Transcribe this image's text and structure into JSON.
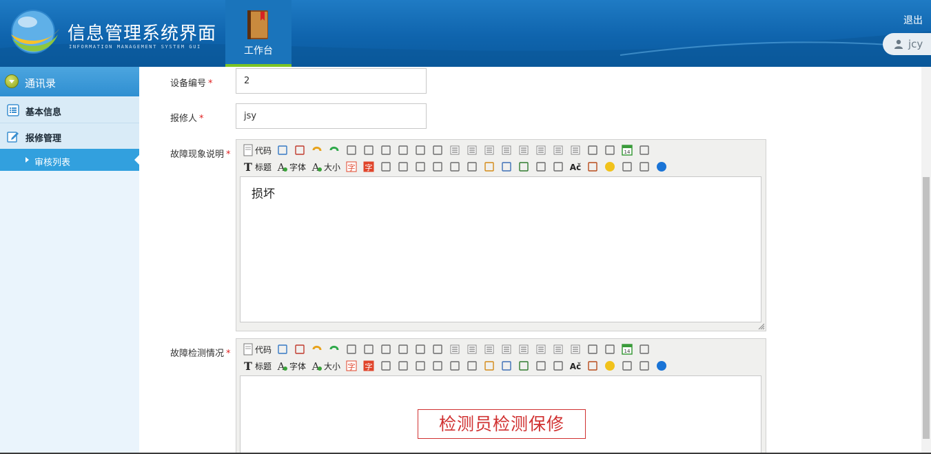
{
  "header": {
    "title": "信息管理系统界面",
    "subtitle": "INFORMATION MANAGEMENT SYSTEM GUI",
    "worktab_label": "工作台",
    "logout_label": "退出",
    "username": "jcy"
  },
  "sidebar": {
    "group_label": "通讯录",
    "items": [
      {
        "label": "基本信息",
        "icon": "list-icon"
      },
      {
        "label": "报修管理",
        "icon": "edit-icon"
      }
    ],
    "sub_item_label": "审核列表"
  },
  "form": {
    "device_no": {
      "label": "设备编号",
      "value": "2"
    },
    "reporter": {
      "label": "报修人",
      "value": "jsy"
    },
    "fault_desc": {
      "label": "故障现象说明",
      "content": "损坏"
    },
    "fault_check": {
      "label": "故障检测情况",
      "content": "检测员检测保修"
    },
    "required_mark": "*"
  },
  "toolbar": {
    "code_label": "代码",
    "heading_label": "标题",
    "font_label": "字体",
    "size_label": "大小",
    "char_label": "字",
    "calendar_day": "14"
  },
  "colors": {
    "header_bg": "#0f64ad",
    "sidebar_active": "#32a0de",
    "required": "#e02020",
    "stamp": "#d03030"
  }
}
